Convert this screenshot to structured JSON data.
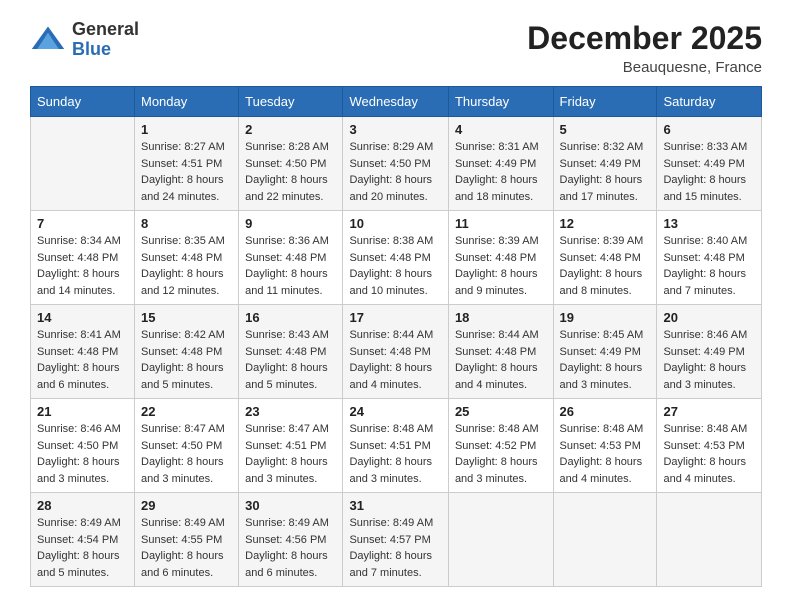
{
  "header": {
    "logo_general": "General",
    "logo_blue": "Blue",
    "month_year": "December 2025",
    "location": "Beauquesne, France"
  },
  "days_of_week": [
    "Sunday",
    "Monday",
    "Tuesday",
    "Wednesday",
    "Thursday",
    "Friday",
    "Saturday"
  ],
  "weeks": [
    [
      {
        "day": "",
        "info": ""
      },
      {
        "day": "1",
        "info": "Sunrise: 8:27 AM\nSunset: 4:51 PM\nDaylight: 8 hours\nand 24 minutes."
      },
      {
        "day": "2",
        "info": "Sunrise: 8:28 AM\nSunset: 4:50 PM\nDaylight: 8 hours\nand 22 minutes."
      },
      {
        "day": "3",
        "info": "Sunrise: 8:29 AM\nSunset: 4:50 PM\nDaylight: 8 hours\nand 20 minutes."
      },
      {
        "day": "4",
        "info": "Sunrise: 8:31 AM\nSunset: 4:49 PM\nDaylight: 8 hours\nand 18 minutes."
      },
      {
        "day": "5",
        "info": "Sunrise: 8:32 AM\nSunset: 4:49 PM\nDaylight: 8 hours\nand 17 minutes."
      },
      {
        "day": "6",
        "info": "Sunrise: 8:33 AM\nSunset: 4:49 PM\nDaylight: 8 hours\nand 15 minutes."
      }
    ],
    [
      {
        "day": "7",
        "info": "Sunrise: 8:34 AM\nSunset: 4:48 PM\nDaylight: 8 hours\nand 14 minutes."
      },
      {
        "day": "8",
        "info": "Sunrise: 8:35 AM\nSunset: 4:48 PM\nDaylight: 8 hours\nand 12 minutes."
      },
      {
        "day": "9",
        "info": "Sunrise: 8:36 AM\nSunset: 4:48 PM\nDaylight: 8 hours\nand 11 minutes."
      },
      {
        "day": "10",
        "info": "Sunrise: 8:38 AM\nSunset: 4:48 PM\nDaylight: 8 hours\nand 10 minutes."
      },
      {
        "day": "11",
        "info": "Sunrise: 8:39 AM\nSunset: 4:48 PM\nDaylight: 8 hours\nand 9 minutes."
      },
      {
        "day": "12",
        "info": "Sunrise: 8:39 AM\nSunset: 4:48 PM\nDaylight: 8 hours\nand 8 minutes."
      },
      {
        "day": "13",
        "info": "Sunrise: 8:40 AM\nSunset: 4:48 PM\nDaylight: 8 hours\nand 7 minutes."
      }
    ],
    [
      {
        "day": "14",
        "info": "Sunrise: 8:41 AM\nSunset: 4:48 PM\nDaylight: 8 hours\nand 6 minutes."
      },
      {
        "day": "15",
        "info": "Sunrise: 8:42 AM\nSunset: 4:48 PM\nDaylight: 8 hours\nand 5 minutes."
      },
      {
        "day": "16",
        "info": "Sunrise: 8:43 AM\nSunset: 4:48 PM\nDaylight: 8 hours\nand 5 minutes."
      },
      {
        "day": "17",
        "info": "Sunrise: 8:44 AM\nSunset: 4:48 PM\nDaylight: 8 hours\nand 4 minutes."
      },
      {
        "day": "18",
        "info": "Sunrise: 8:44 AM\nSunset: 4:48 PM\nDaylight: 8 hours\nand 4 minutes."
      },
      {
        "day": "19",
        "info": "Sunrise: 8:45 AM\nSunset: 4:49 PM\nDaylight: 8 hours\nand 3 minutes."
      },
      {
        "day": "20",
        "info": "Sunrise: 8:46 AM\nSunset: 4:49 PM\nDaylight: 8 hours\nand 3 minutes."
      }
    ],
    [
      {
        "day": "21",
        "info": "Sunrise: 8:46 AM\nSunset: 4:50 PM\nDaylight: 8 hours\nand 3 minutes."
      },
      {
        "day": "22",
        "info": "Sunrise: 8:47 AM\nSunset: 4:50 PM\nDaylight: 8 hours\nand 3 minutes."
      },
      {
        "day": "23",
        "info": "Sunrise: 8:47 AM\nSunset: 4:51 PM\nDaylight: 8 hours\nand 3 minutes."
      },
      {
        "day": "24",
        "info": "Sunrise: 8:48 AM\nSunset: 4:51 PM\nDaylight: 8 hours\nand 3 minutes."
      },
      {
        "day": "25",
        "info": "Sunrise: 8:48 AM\nSunset: 4:52 PM\nDaylight: 8 hours\nand 3 minutes."
      },
      {
        "day": "26",
        "info": "Sunrise: 8:48 AM\nSunset: 4:53 PM\nDaylight: 8 hours\nand 4 minutes."
      },
      {
        "day": "27",
        "info": "Sunrise: 8:48 AM\nSunset: 4:53 PM\nDaylight: 8 hours\nand 4 minutes."
      }
    ],
    [
      {
        "day": "28",
        "info": "Sunrise: 8:49 AM\nSunset: 4:54 PM\nDaylight: 8 hours\nand 5 minutes."
      },
      {
        "day": "29",
        "info": "Sunrise: 8:49 AM\nSunset: 4:55 PM\nDaylight: 8 hours\nand 6 minutes."
      },
      {
        "day": "30",
        "info": "Sunrise: 8:49 AM\nSunset: 4:56 PM\nDaylight: 8 hours\nand 6 minutes."
      },
      {
        "day": "31",
        "info": "Sunrise: 8:49 AM\nSunset: 4:57 PM\nDaylight: 8 hours\nand 7 minutes."
      },
      {
        "day": "",
        "info": ""
      },
      {
        "day": "",
        "info": ""
      },
      {
        "day": "",
        "info": ""
      }
    ]
  ]
}
